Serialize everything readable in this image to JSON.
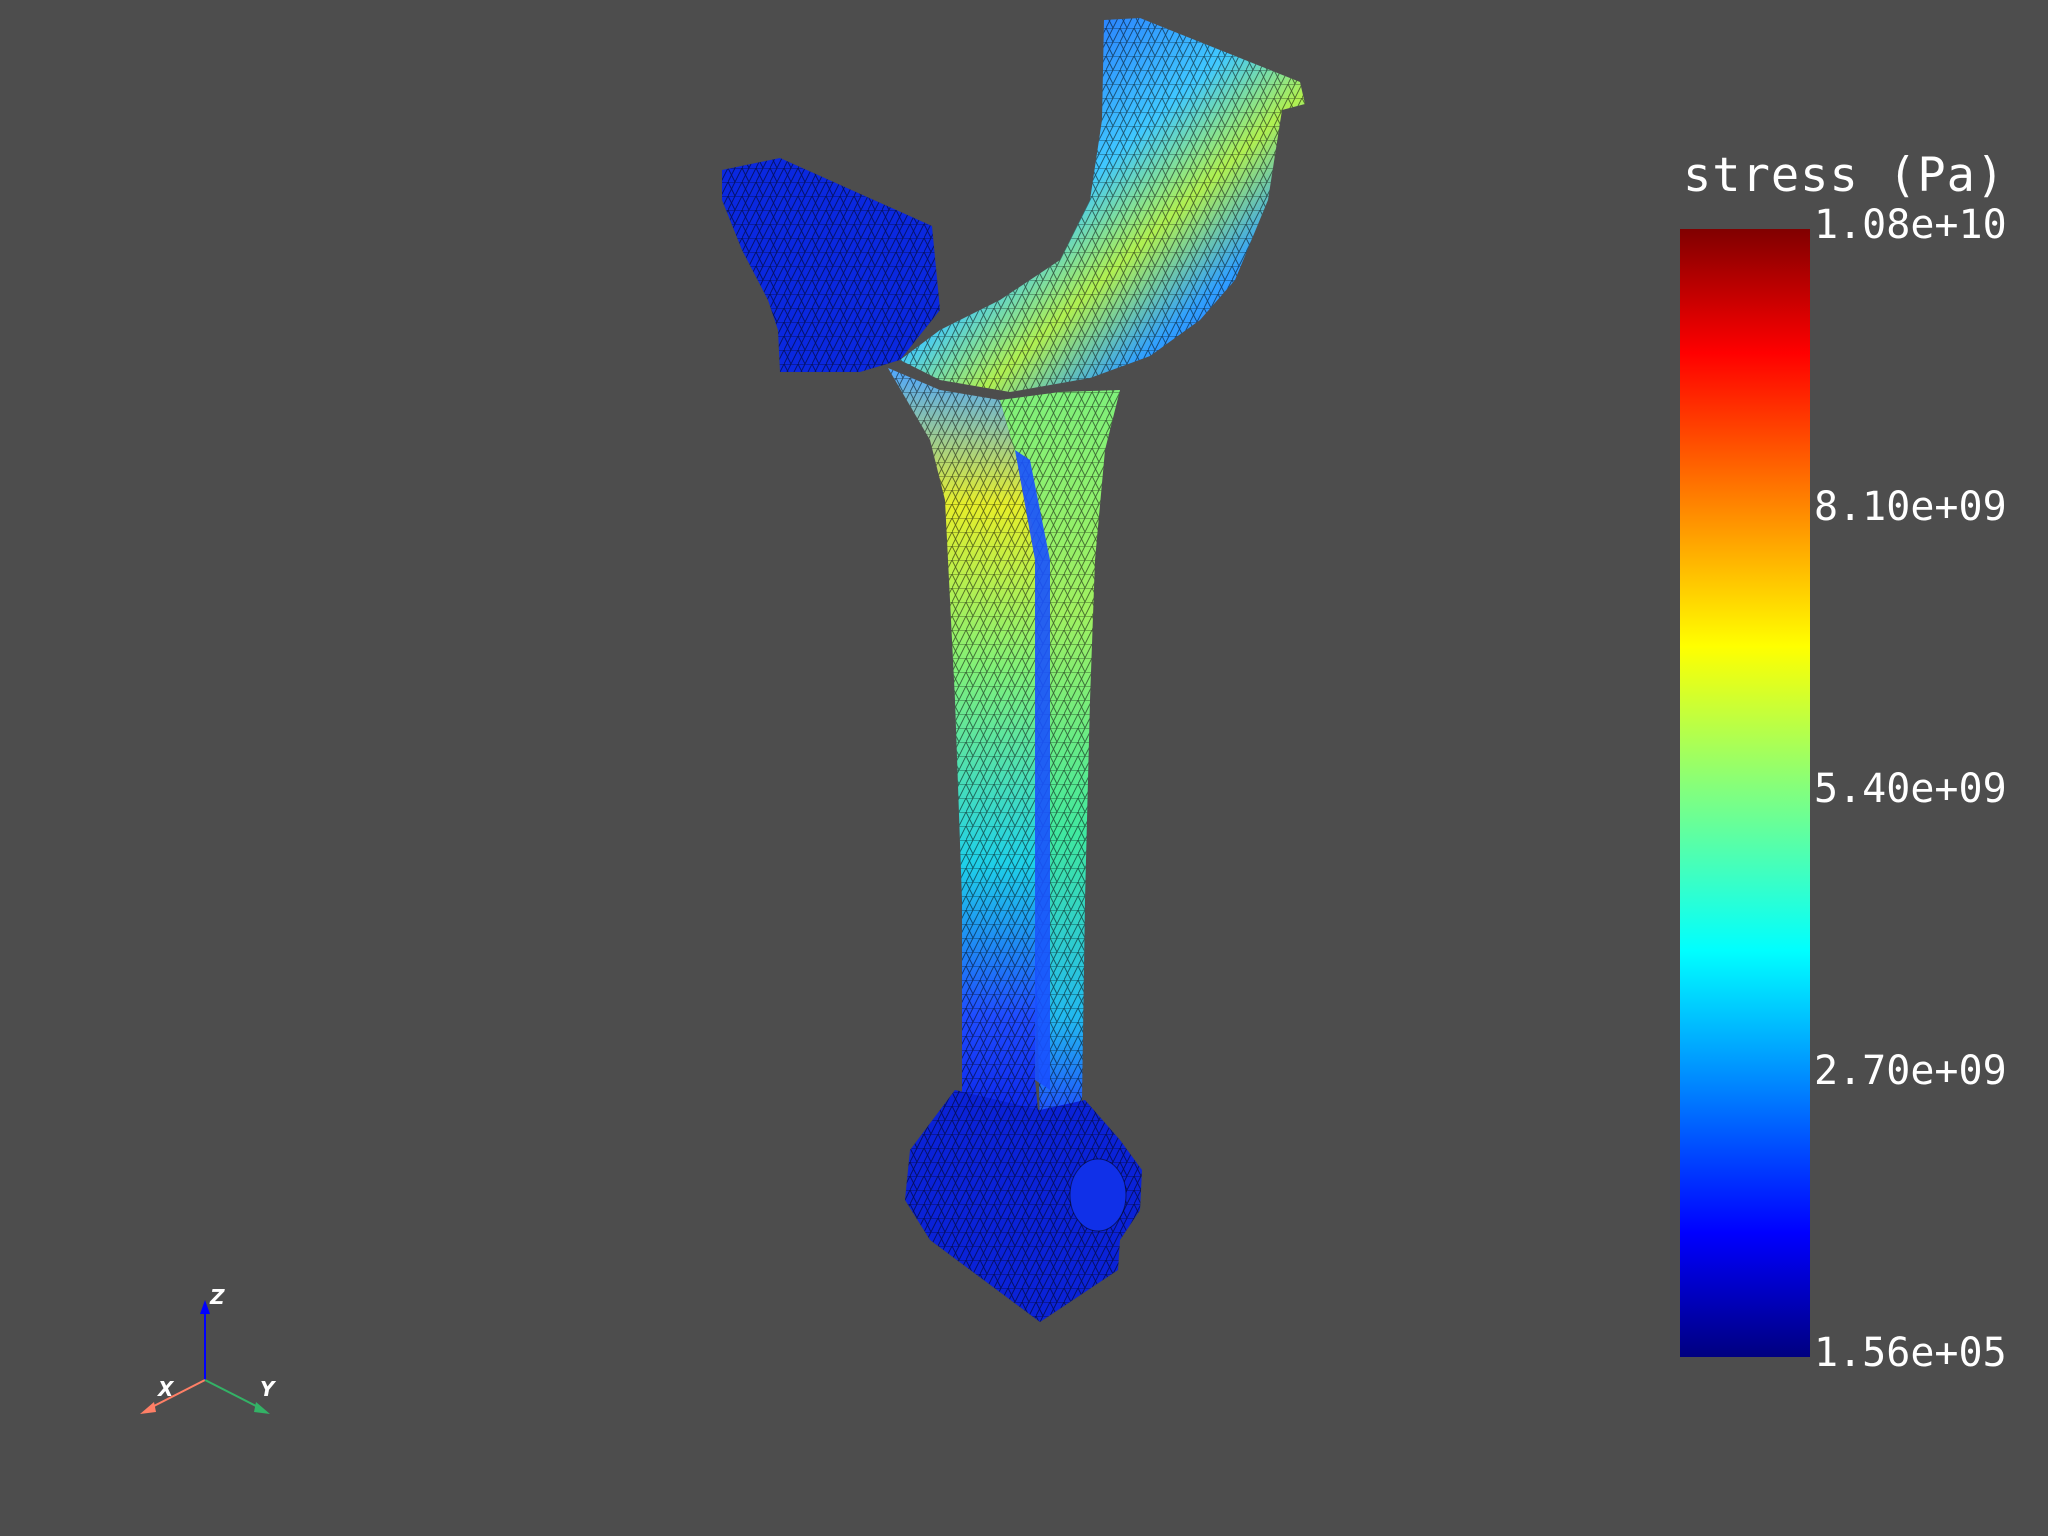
{
  "scalar_bar": {
    "title": "stress (Pa)",
    "tick_labels": [
      "1.08e+10",
      "8.10e+09",
      "5.40e+09",
      "2.70e+09",
      "1.56e+05"
    ],
    "range": [
      156000,
      10800000000
    ],
    "colormap": "jet",
    "colors": [
      "#000080",
      "#0000ff",
      "#00ffff",
      "#80ff80",
      "#ffff00",
      "#ff8000",
      "#ff0000",
      "#800000"
    ]
  },
  "axes": {
    "z_label": "Z",
    "x_label": "X",
    "y_label": "Y",
    "z_color": "#0000ff",
    "x_color": "#ff7f66",
    "y_color": "#33b266"
  },
  "colors": {
    "background": "#4d4d4d",
    "text": "#ffffff"
  }
}
